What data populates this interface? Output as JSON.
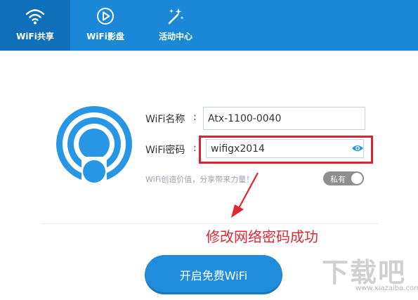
{
  "tabs": [
    {
      "label": "WiFi共享",
      "icon": "wifi-icon",
      "active": true
    },
    {
      "label": "WiFi影盘",
      "icon": "play-icon",
      "active": false
    },
    {
      "label": "活动中心",
      "icon": "magic-wand-icon",
      "active": false
    }
  ],
  "form": {
    "name_label": "WiFi名称",
    "password_label": "WiFi密码",
    "colon": ":",
    "name_value": "Atx-1100-0040",
    "password_value": "wifigx2014",
    "slogan": "WiFi创造价值，分享带来力量！",
    "private_toggle_label": "私有",
    "private_toggle_on": false
  },
  "annotation": "修改网络密码成功",
  "start_button_label": "开启免费WiFi",
  "watermark": {
    "text": "下载吧",
    "url": "www.xiazaiba.com"
  },
  "colors": {
    "accent": "#1a88d6",
    "highlight": "#d8252f",
    "annotation": "#e0262f"
  }
}
